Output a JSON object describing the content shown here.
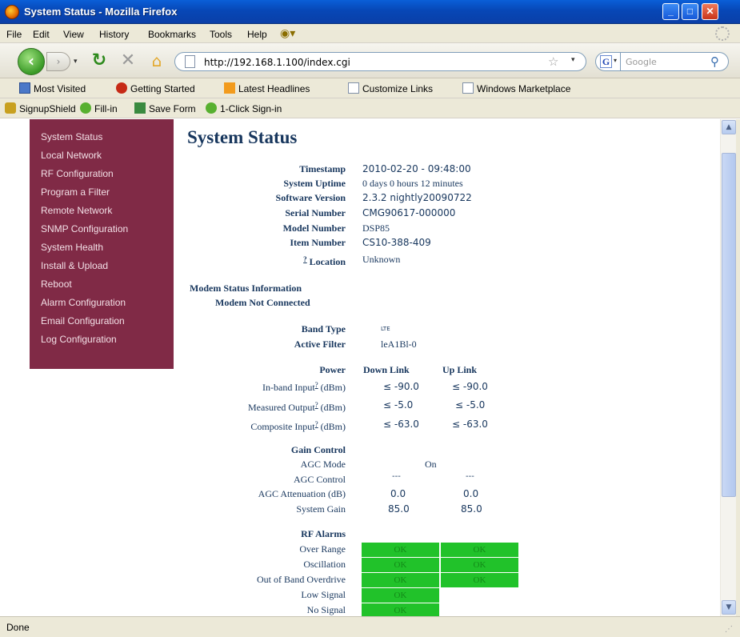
{
  "window": {
    "title": "System Status - Mozilla Firefox"
  },
  "menu": [
    "File",
    "Edit",
    "View",
    "History",
    "Bookmarks",
    "Tools",
    "Help"
  ],
  "nav": {
    "url": "http://192.168.1.100/index.cgi",
    "search_placeholder": "Google"
  },
  "bookmarks": [
    "Most Visited",
    "Getting Started",
    "Latest Headlines",
    "Customize Links",
    "Windows Marketplace"
  ],
  "addons": [
    "SignupShield",
    "Fill-in",
    "Save Form",
    "1-Click Sign-in"
  ],
  "sidebar": [
    "System Status",
    "Local Network",
    "RF Configuration",
    "Program a Filter",
    "Remote Network",
    "SNMP Configuration",
    "System Health",
    "Install & Upload",
    "Reboot",
    "Alarm Configuration",
    "Email Configuration",
    "Log Configuration"
  ],
  "page": {
    "title": "System Status",
    "info": [
      {
        "label": "Timestamp",
        "value": "2010-02-20 - 09:48:00"
      },
      {
        "label": "System Uptime",
        "value": "0 days 0 hours 12 minutes"
      },
      {
        "label": "Software Version",
        "value": "2.3.2 nightly20090722"
      },
      {
        "label": "Serial Number",
        "value": "CMG90617-000000"
      },
      {
        "label": "Model Number",
        "value": "DSP85"
      },
      {
        "label": "Item Number",
        "value": "CS10-388-409"
      }
    ],
    "location": {
      "help": "?",
      "label": "Location",
      "value": "Unknown"
    },
    "modem": {
      "heading": "Modem Status Information",
      "status": "Modem Not Connected"
    },
    "band": {
      "label": "Band Type",
      "value": "LTE"
    },
    "filter": {
      "label": "Active Filter",
      "value": "leA1Bl-0"
    },
    "power": {
      "heading": "Power",
      "col_down": "Down Link",
      "col_up": "Up Link",
      "rows": [
        {
          "label": "In-band Input",
          "unit": "(dBm)",
          "down": "≤ -90.0",
          "up": "≤ -90.0"
        },
        {
          "label": "Measured Output",
          "unit": "(dBm)",
          "down": "≤ -5.0",
          "up": "≤ -5.0"
        },
        {
          "label": "Composite Input",
          "unit": "(dBm)",
          "down": "≤ -63.0",
          "up": "≤ -63.0"
        }
      ]
    },
    "gain": {
      "heading": "Gain Control",
      "agc_mode": {
        "label": "AGC Mode",
        "value": "On"
      },
      "agc_control": {
        "label": "AGC Control",
        "down": "---",
        "up": "---"
      },
      "agc_atten": {
        "label": "AGC Attenuation (dB)",
        "down": "0.0",
        "up": "0.0"
      },
      "system_gain": {
        "label": "System Gain",
        "down": "85.0",
        "up": "85.0"
      }
    },
    "alarms": {
      "heading": "RF Alarms",
      "rows": [
        {
          "label": "Over Range",
          "down": "OK",
          "up": "OK"
        },
        {
          "label": "Oscillation",
          "down": "OK",
          "up": "OK"
        },
        {
          "label": "Out of Band Overdrive",
          "down": "OK",
          "up": "OK"
        },
        {
          "label": "Low Signal",
          "down": "OK"
        },
        {
          "label": "No Signal",
          "down": "OK"
        }
      ]
    }
  },
  "status": "Done",
  "colors": {
    "sidebar_bg": "#802a46",
    "text_navy": "#17365d",
    "ok_green": "#21c22a"
  }
}
